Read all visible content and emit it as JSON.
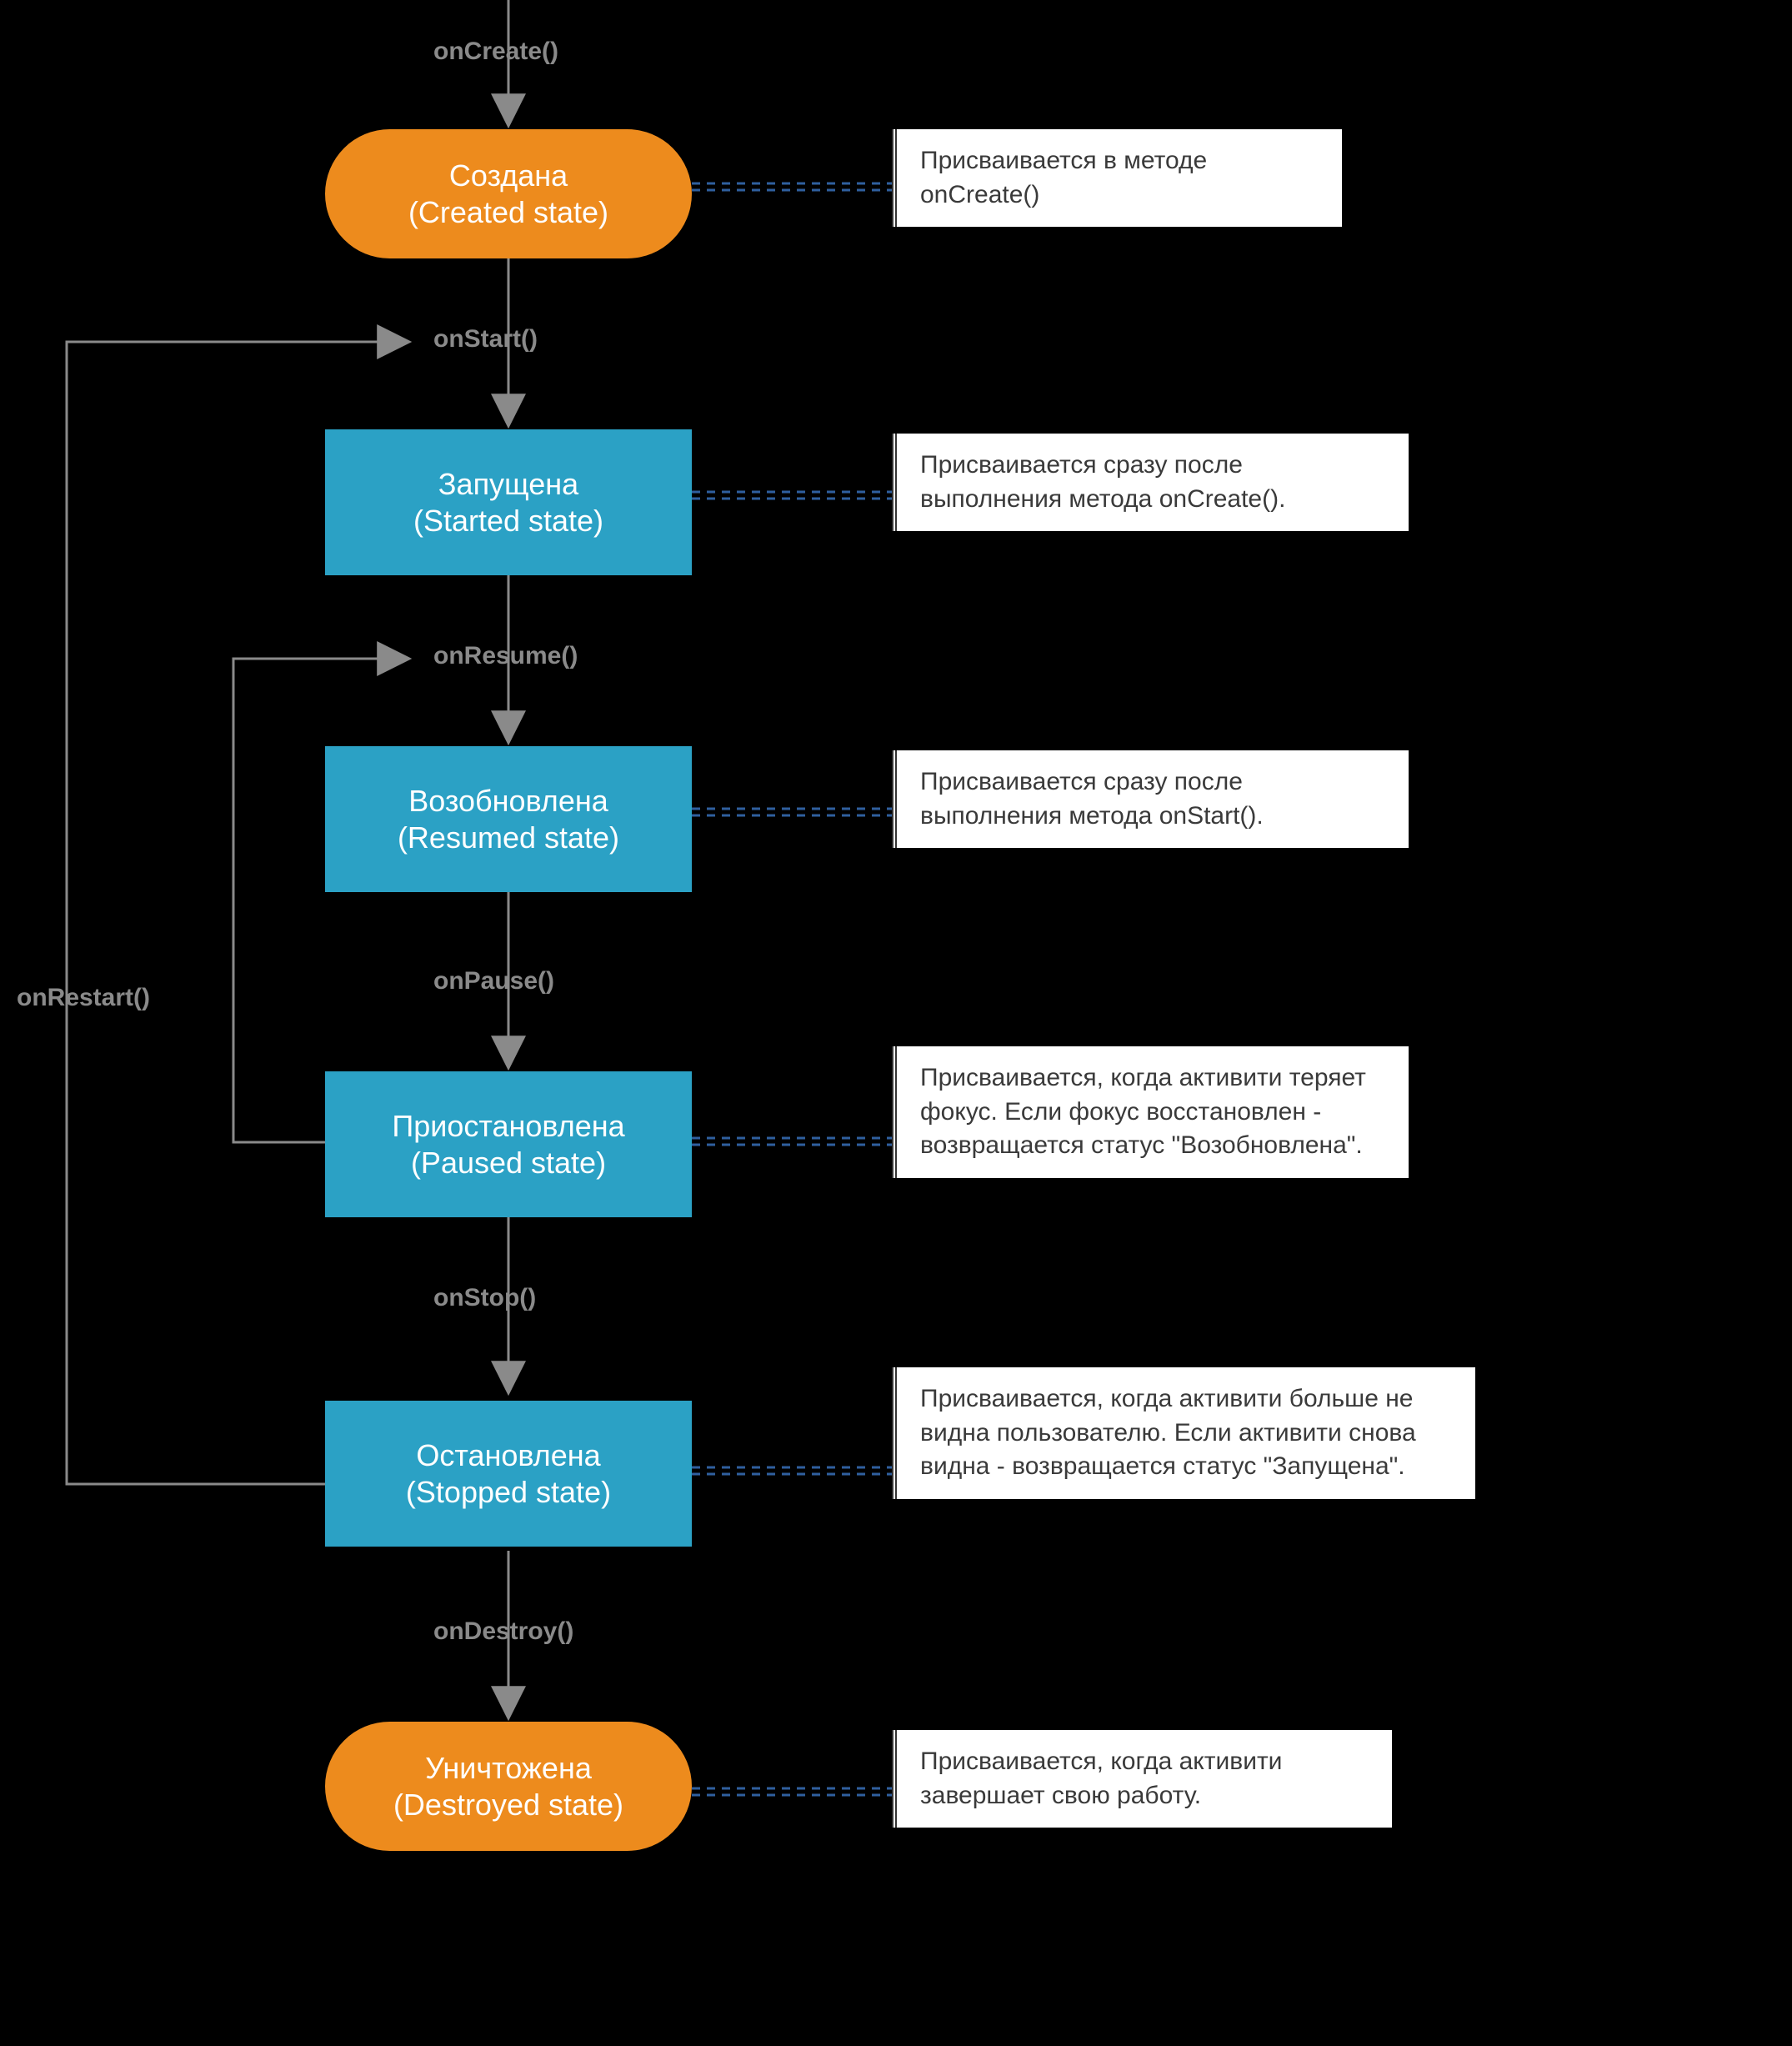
{
  "diagram": {
    "nodes": {
      "created": {
        "title": "Создана",
        "subtitle": "(Created state)"
      },
      "started": {
        "title": "Запущена",
        "subtitle": "(Started state)"
      },
      "resumed": {
        "title": "Возобновлена",
        "subtitle": "(Resumed state)"
      },
      "paused": {
        "title": "Приостановлена",
        "subtitle": "(Paused state)"
      },
      "stopped": {
        "title": "Остановлена",
        "subtitle": "(Stopped state)"
      },
      "destroyed": {
        "title": "Уничтожена",
        "subtitle": "(Destroyed state)"
      }
    },
    "methods": {
      "onCreate": "onCreate()",
      "onStart": "onStart()",
      "onResume": "onResume()",
      "onPause": "onPause()",
      "onStop": "onStop()",
      "onDestroy": "onDestroy()",
      "onRestart": "onRestart()"
    },
    "descriptions": {
      "created": "Присваивается в методе onCreate()",
      "started": "Присваивается сразу после выполнения метода onCreate().",
      "resumed": "Присваивается сразу после выполнения метода onStart().",
      "paused": "Присваивается, когда активити теряет фокус. Если фокус восстановлен - возвращается статус \"Возобновлена\".",
      "stopped": "Присваивается, когда активити больше не видна пользователю. Если активити снова видна - возвращается статус \"Запущена\".",
      "destroyed": "Присваивается, когда активити завершает свою работу."
    }
  },
  "colors": {
    "orange": "#ED8B1D",
    "blue": "#2BA1C5",
    "line": "#8A8A8A",
    "dash": "#2F5F9E"
  },
  "chart_data": {
    "type": "flowchart",
    "title": "Android Activity lifecycle",
    "nodes": [
      {
        "id": "created",
        "label": "Создана (Created state)",
        "shape": "rounded",
        "color": "#ED8B1D"
      },
      {
        "id": "started",
        "label": "Запущена (Started state)",
        "shape": "rect",
        "color": "#2BA1C5"
      },
      {
        "id": "resumed",
        "label": "Возобновлена (Resumed state)",
        "shape": "rect",
        "color": "#2BA1C5"
      },
      {
        "id": "paused",
        "label": "Приостановлена (Paused state)",
        "shape": "rect",
        "color": "#2BA1C5"
      },
      {
        "id": "stopped",
        "label": "Остановлена (Stopped state)",
        "shape": "rect",
        "color": "#2BA1C5"
      },
      {
        "id": "destroyed",
        "label": "Уничтожена (Destroyed state)",
        "shape": "rounded",
        "color": "#ED8B1D"
      }
    ],
    "edges": [
      {
        "from": null,
        "to": "created",
        "label": "onCreate()"
      },
      {
        "from": "created",
        "to": "started",
        "label": "onStart()"
      },
      {
        "from": "started",
        "to": "resumed",
        "label": "onResume()"
      },
      {
        "from": "resumed",
        "to": "paused",
        "label": "onPause()"
      },
      {
        "from": "paused",
        "to": "stopped",
        "label": "onStop()"
      },
      {
        "from": "stopped",
        "to": "destroyed",
        "label": "onDestroy()"
      },
      {
        "from": "paused",
        "to": "resumed",
        "label": "onResume()",
        "back": true
      },
      {
        "from": "stopped",
        "to": "started",
        "label": "onRestart()",
        "back": true
      }
    ],
    "annotations": [
      {
        "node": "created",
        "text": "Присваивается в методе onCreate()"
      },
      {
        "node": "started",
        "text": "Присваивается сразу после выполнения метода onCreate()."
      },
      {
        "node": "resumed",
        "text": "Присваивается сразу после выполнения метода onStart()."
      },
      {
        "node": "paused",
        "text": "Присваивается, когда активити теряет фокус. Если фокус восстановлен - возвращается статус \"Возобновлена\"."
      },
      {
        "node": "stopped",
        "text": "Присваивается, когда активити больше не видна пользователю. Если активити снова видна - возвращается статус \"Запущена\"."
      },
      {
        "node": "destroyed",
        "text": "Присваивается, когда активити завершает свою работу."
      }
    ]
  }
}
